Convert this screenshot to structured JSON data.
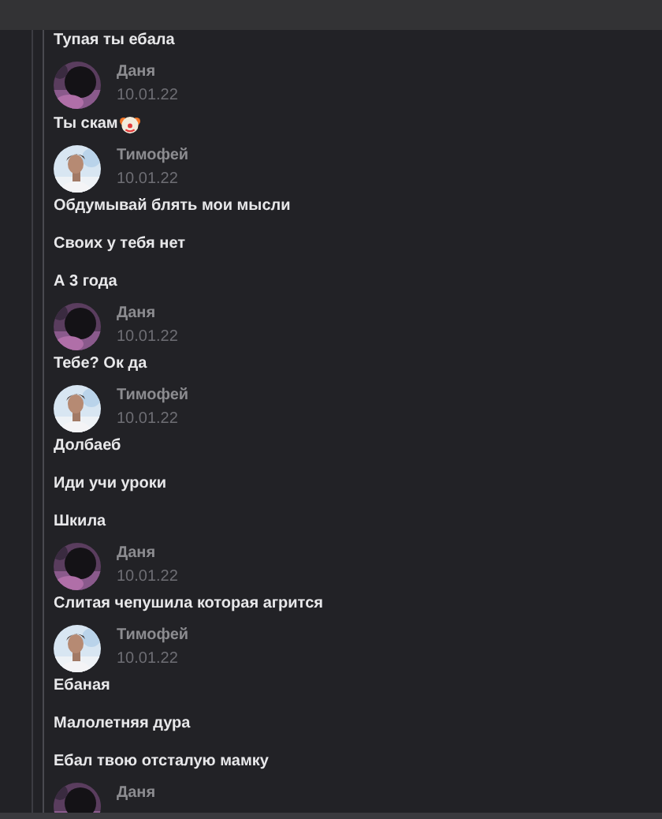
{
  "groups": [
    {
      "messages": [
        {
          "text": "Тупая ты ебала",
          "emoji": false
        }
      ]
    },
    {
      "author": "Даня",
      "date": "10.01.22",
      "messages": [
        {
          "text": "Ты скам",
          "emoji": true
        }
      ]
    },
    {
      "author": "Тимофей",
      "date": "10.01.22",
      "messages": [
        {
          "text": "Обдумывай блять мои мысли",
          "emoji": false
        },
        {
          "text": "Своих у тебя нет",
          "emoji": false
        },
        {
          "text": "А 3 года",
          "emoji": false
        }
      ]
    },
    {
      "author": "Даня",
      "date": "10.01.22",
      "messages": [
        {
          "text": "Тебе? Ок да",
          "emoji": false
        }
      ]
    },
    {
      "author": "Тимофей",
      "date": "10.01.22",
      "messages": [
        {
          "text": "Долбаеб",
          "emoji": false
        },
        {
          "text": "Иди учи уроки",
          "emoji": false
        },
        {
          "text": "Шкила",
          "emoji": false
        }
      ]
    },
    {
      "author": "Даня",
      "date": "10.01.22",
      "messages": [
        {
          "text": "Слитая чепушила которая агрится",
          "emoji": false
        }
      ]
    },
    {
      "author": "Тимофей",
      "date": "10.01.22",
      "messages": [
        {
          "text": "Ебаная",
          "emoji": false
        },
        {
          "text": "Малолетняя дура",
          "emoji": false
        },
        {
          "text": "Ебал твою отсталую мамку",
          "emoji": false
        }
      ]
    },
    {
      "author": "Даня"
    }
  ]
}
